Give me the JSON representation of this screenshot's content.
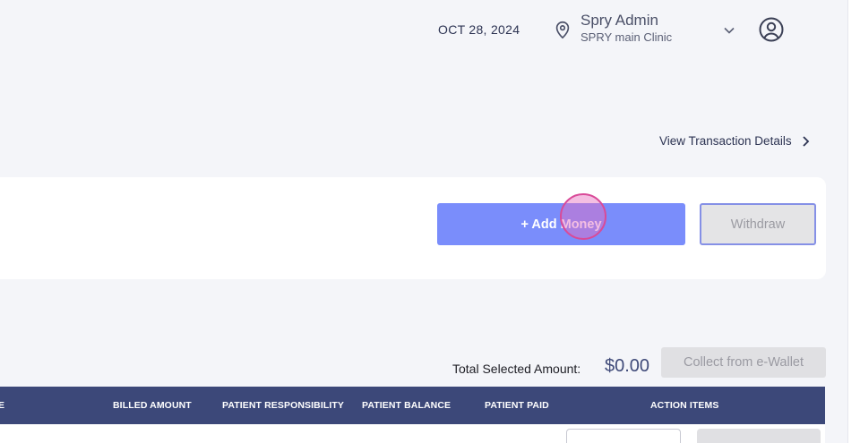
{
  "header": {
    "date": "OCT 28, 2024",
    "user_name": "Spry Admin",
    "clinic_name": "SPRY main Clinic",
    "icons": [
      "location-pin-icon",
      "chevron-down-icon",
      "user-circle-icon"
    ]
  },
  "wallet": {
    "view_transaction_label": "View Transaction Details",
    "add_money_label": "+ Add Money",
    "withdraw_label": "Withdraw"
  },
  "summary": {
    "total_label": "Total Selected Amount:",
    "total_value": "$0.00",
    "collect_wallet_label": "Collect from e-Wallet"
  },
  "table": {
    "columns": [
      "E",
      "BILLED AMOUNT",
      "PATIENT RESPONSIBILITY",
      "PATIENT BALANCE",
      "PATIENT PAID",
      "ACTION ITEMS"
    ],
    "header_color": "#3c4879"
  },
  "colors": {
    "primary_button": "#7a8dfb",
    "navy": "#3c4879",
    "background": "#f4f5f9"
  }
}
